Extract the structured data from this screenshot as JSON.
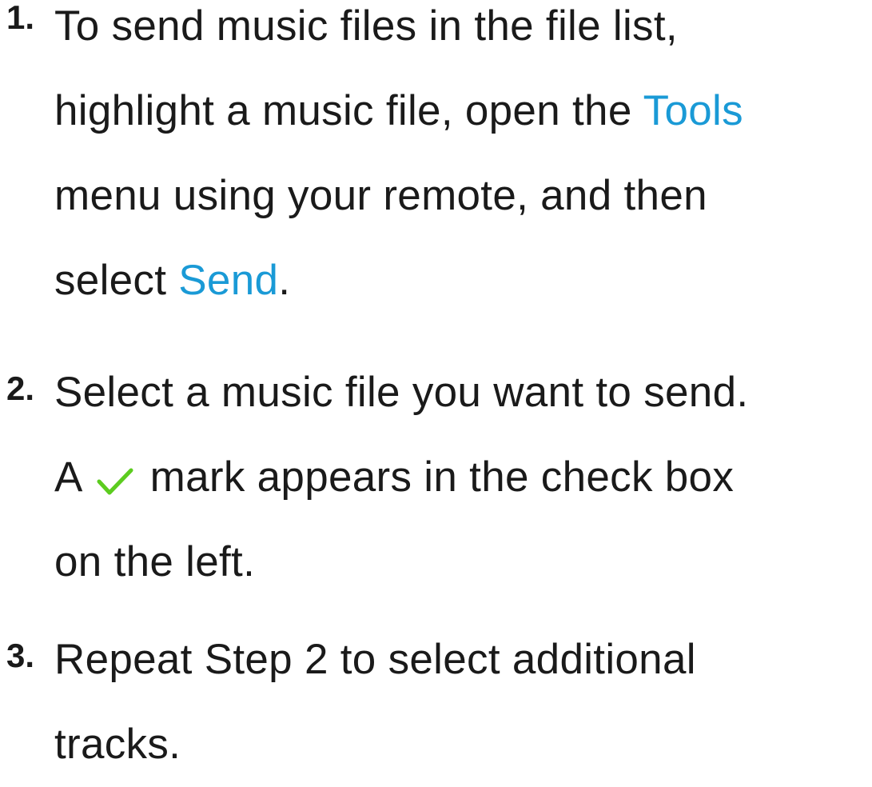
{
  "steps": [
    {
      "number": "1.",
      "lines": [
        {
          "text": "To send music files in the file list,"
        },
        {
          "before": "highlight a music file, open the ",
          "highlight": "Tools"
        },
        {
          "text": "menu using your remote, and then"
        },
        {
          "before": "select ",
          "highlight": "Send",
          "after": "."
        }
      ]
    },
    {
      "number": "2.",
      "lines": [
        {
          "text": "Select a music file you want to send."
        },
        {
          "before": "A",
          "icon": "checkmark-icon",
          "after": "mark appears in the check box"
        },
        {
          "text": "on the left."
        }
      ]
    },
    {
      "number": "3.",
      "lines": [
        {
          "text": "Repeat Step 2 to select additional"
        },
        {
          "text": "tracks."
        }
      ]
    }
  ],
  "colors": {
    "highlight": "#1a9ad6",
    "checkmark": "#5ccc1f",
    "text": "#1a1a1a"
  }
}
